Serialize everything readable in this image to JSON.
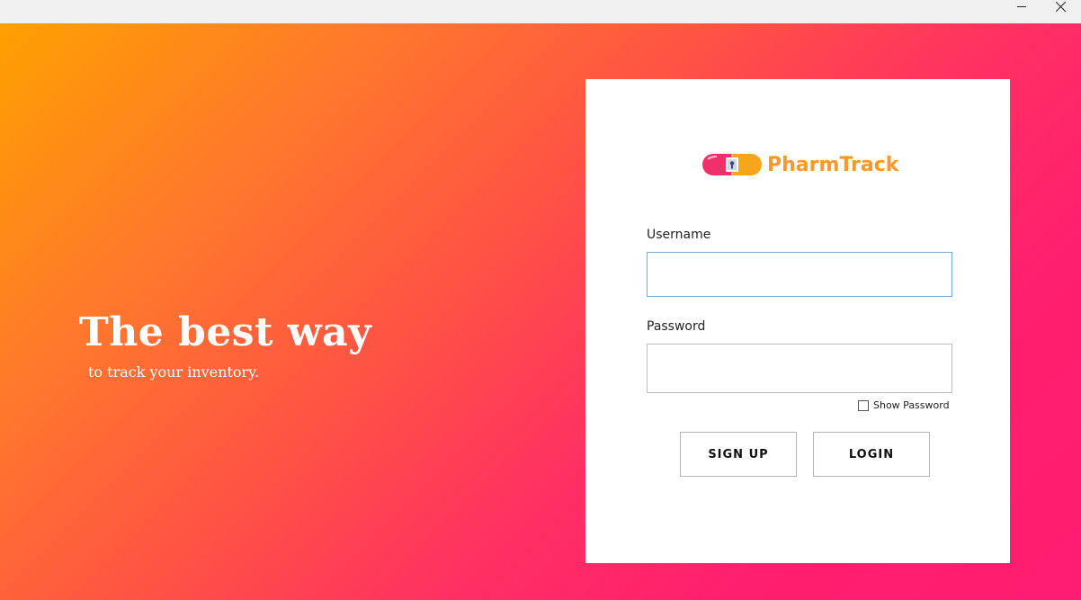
{
  "window": {
    "minimize_icon": "minimize-icon",
    "close_icon": "close-icon"
  },
  "hero": {
    "title": "The best way",
    "subtitle": "to track your inventory."
  },
  "brand": {
    "logo_icon": "pill-lock-icon",
    "name": "PharmTrack",
    "color": "#f79a2a",
    "logo_pink": "#f0306b",
    "logo_orange": "#f7a51b"
  },
  "form": {
    "username_label": "Username",
    "username_value": "",
    "password_label": "Password",
    "password_value": "",
    "show_password_label": "Show Password",
    "show_password_checked": false
  },
  "buttons": {
    "signup_label": "SIGN UP",
    "login_label": "LOGIN"
  },
  "colors": {
    "gradient_start": "#ffa000",
    "gradient_end": "#ff1c70",
    "input_focus_border": "#7aa7cf"
  }
}
